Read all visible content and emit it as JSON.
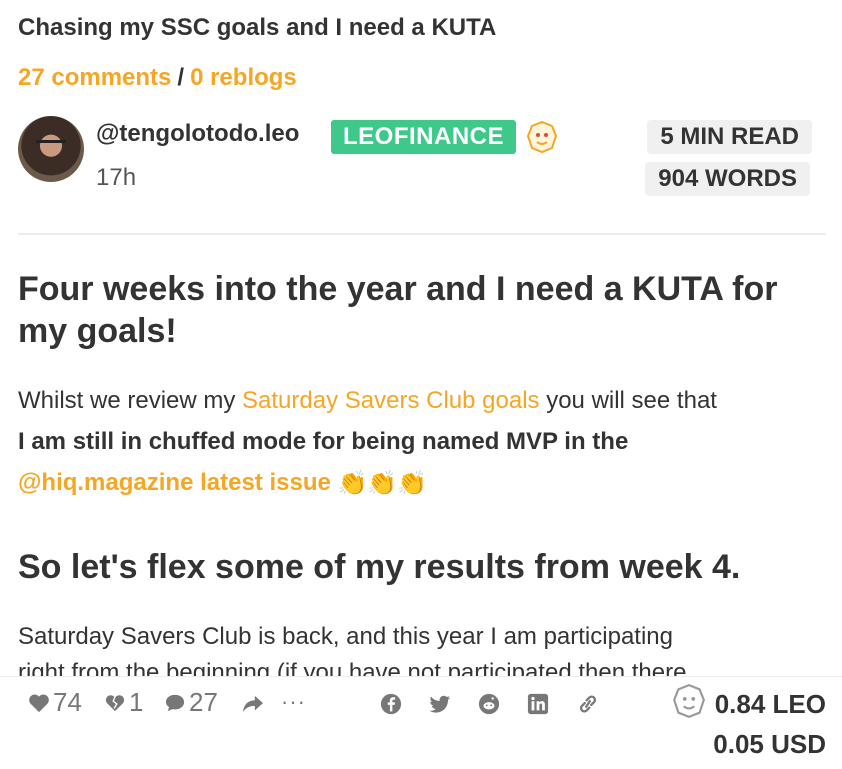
{
  "post": {
    "title": "Chasing my SSC goals and I need a KUTA",
    "comments": "27 comments",
    "separator": "/",
    "reblogs": "0 reblogs"
  },
  "author": {
    "handle": "@tengolotodo.leo",
    "community": "LEOFINANCE",
    "time": "17h",
    "read_time": "5 MIN READ",
    "word_count": "904 WORDS"
  },
  "content": {
    "heading1": "Four weeks into the year and I need a KUTA for my goals!",
    "para1_start": "Whilst we review my ",
    "para1_link": "Saturday Savers Club goals",
    "para1_mid": " you will see that ",
    "para1_bold": "I am still in chuffed mode for being named MVP in the",
    "para1_link2": "@hiq.magazine latest issue",
    "claps": "👏👏👏",
    "heading2": "So let's flex some of my results from week 4.",
    "para2": "Saturday Savers Club is back, and this year I am participating",
    "para2_cut": "right from the beginning (if you have not participated then there"
  },
  "footer": {
    "upvotes": "74",
    "downvotes": "1",
    "comments": "27",
    "more": "···",
    "reward_leo": "0.84 LEO",
    "reward_usd": "0.05 USD"
  },
  "icons": {
    "upvote": "heart-icon",
    "downvote": "broken-heart-icon",
    "comment": "speech-bubble-icon",
    "reblog": "share-arrow-icon",
    "facebook": "facebook-icon",
    "twitter": "twitter-icon",
    "reddit": "reddit-icon",
    "linkedin": "linkedin-icon",
    "copy_link": "link-icon"
  },
  "colors": {
    "accent": "#f5a623",
    "community_badge": "#3ec98a",
    "pill_bg": "#f0f0f0",
    "text": "#333333",
    "muted": "#777777"
  }
}
